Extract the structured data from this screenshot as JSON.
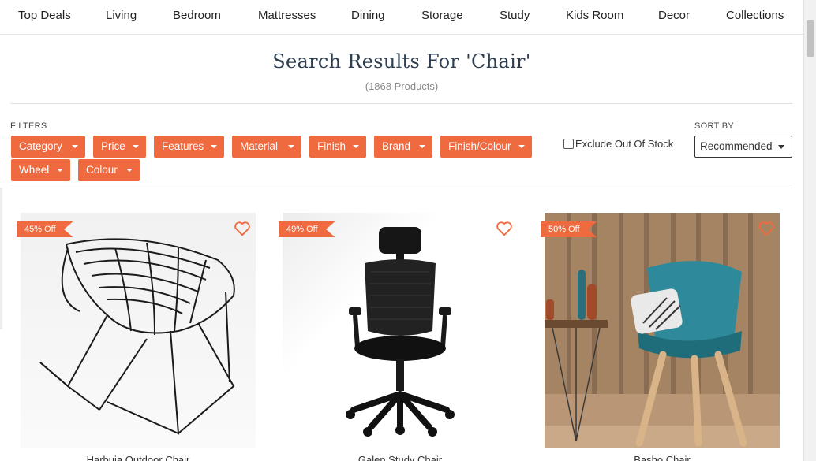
{
  "nav": {
    "items": [
      {
        "label": "Top Deals"
      },
      {
        "label": "Living"
      },
      {
        "label": "Bedroom"
      },
      {
        "label": "Mattresses"
      },
      {
        "label": "Dining"
      },
      {
        "label": "Storage"
      },
      {
        "label": "Study"
      },
      {
        "label": "Kids Room"
      },
      {
        "label": "Decor"
      },
      {
        "label": "Collections"
      }
    ]
  },
  "search": {
    "title": "Search Results For 'Chair'",
    "count": "(1868 Products)"
  },
  "filters": {
    "label": "FILTERS",
    "chips": [
      {
        "label": "Category"
      },
      {
        "label": "Price"
      },
      {
        "label": "Features"
      },
      {
        "label": "Material"
      },
      {
        "label": "Finish"
      },
      {
        "label": "Brand"
      },
      {
        "label": "Finish/Colour"
      },
      {
        "label": "Wheel"
      },
      {
        "label": "Colour"
      }
    ],
    "exclude_label": "Exclude Out Of Stock",
    "exclude_checked": false
  },
  "sort": {
    "label": "SORT BY",
    "selected": "Recommended"
  },
  "products": [
    {
      "name": "Harbuia Outdoor Chair",
      "discount": "45% Off",
      "icon": "wire-chair"
    },
    {
      "name": "Galen Study Chair",
      "discount": "49% Off",
      "icon": "office-chair"
    },
    {
      "name": "Basho Chair",
      "discount": "50% Off",
      "icon": "teal-chair"
    }
  ],
  "colors": {
    "accent": "#f06a3f",
    "title": "#2c3e50"
  }
}
